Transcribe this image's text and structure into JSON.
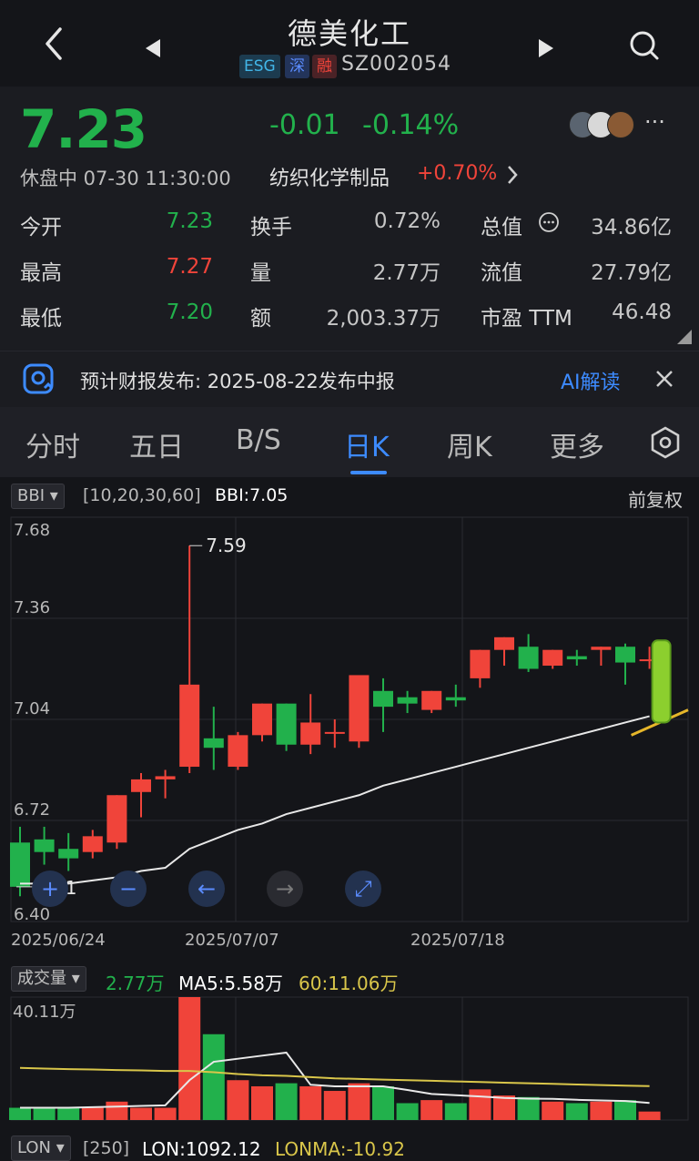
{
  "header": {
    "back_icon": "chevron-left-icon",
    "prev_icon": "triangle-left-icon",
    "next_icon": "triangle-right-icon",
    "search_icon": "search-icon",
    "title": "德美化工",
    "badges": [
      "ESG",
      "深",
      "融"
    ],
    "code": "SZ002054"
  },
  "quote": {
    "price": "7.23",
    "change": "-0.01",
    "change_pct": "-0.14%",
    "status": "休盘中 07-30 11:30:00",
    "sector": "纺织化学制品",
    "sector_change": "+0.70%",
    "more_icon": "more-icon",
    "rows": [
      {
        "l1": "今开",
        "v1": "7.23",
        "l2": "换手",
        "v2": "0.72%",
        "l3": "总值",
        "v3": "34.86亿"
      },
      {
        "l1": "最高",
        "v1": "7.27",
        "l2": "量",
        "v2": "2.77万",
        "l3": "流值",
        "v3": "27.79亿"
      },
      {
        "l1": "最低",
        "v1": "7.20",
        "l2": "额",
        "v2": "2,003.37万",
        "l3": "市盈 TTM",
        "v3": "46.48"
      }
    ]
  },
  "notice": {
    "text": "预计财报发布: 2025-08-22发布中报",
    "ai_label": "AI解读",
    "close_icon": "close-icon"
  },
  "tabs": [
    "分时",
    "五日",
    "B/S",
    "日K",
    "周K",
    "更多"
  ],
  "active_tab": "日K",
  "kline": {
    "indicator": "BBI",
    "params": "[10,20,30,60]",
    "bbi_value": "BBI:7.05",
    "adjust": "前复权",
    "y_ticks": [
      "7.68",
      "7.36",
      "7.04",
      "6.72",
      "6.40"
    ],
    "x_ticks": [
      "2025/06/24",
      "2025/07/07",
      "2025/07/18"
    ],
    "high_label": "7.59",
    "low_label": "6.51",
    "controls": [
      "zoom-in-icon",
      "zoom-out-icon",
      "pan-left-icon",
      "pan-right-icon",
      "reset-icon"
    ]
  },
  "volume": {
    "indicator": "成交量",
    "vol": "2.77万",
    "ma5": "MA5:5.58万",
    "ma60": "60:11.06万",
    "max_label": "40.11万"
  },
  "lon": {
    "indicator": "LON",
    "params": "[250]",
    "lon": "LON:1092.12",
    "lonma": "LONMA:-10.92"
  },
  "colors": {
    "up": "#f0443a",
    "down": "#22b14c",
    "accent": "#3d8bff",
    "bbi": "#e8e8e8",
    "ma60": "#d9c64a"
  },
  "chart_data": {
    "type": "candlestick",
    "ylim": [
      6.4,
      7.68
    ],
    "candles": [
      {
        "o": 6.65,
        "c": 6.51,
        "h": 6.7,
        "l": 6.48
      },
      {
        "o": 6.66,
        "c": 6.62,
        "h": 6.7,
        "l": 6.58
      },
      {
        "o": 6.63,
        "c": 6.6,
        "h": 6.68,
        "l": 6.56
      },
      {
        "o": 6.62,
        "c": 6.67,
        "h": 6.69,
        "l": 6.6
      },
      {
        "o": 6.65,
        "c": 6.8,
        "h": 6.8,
        "l": 6.63
      },
      {
        "o": 6.81,
        "c": 6.85,
        "h": 6.87,
        "l": 6.73
      },
      {
        "o": 6.85,
        "c": 6.86,
        "h": 6.88,
        "l": 6.79
      },
      {
        "o": 6.89,
        "c": 7.15,
        "h": 7.59,
        "l": 6.87
      },
      {
        "o": 6.98,
        "c": 6.95,
        "h": 7.08,
        "l": 6.88
      },
      {
        "o": 6.89,
        "c": 6.99,
        "h": 7.0,
        "l": 6.88
      },
      {
        "o": 6.99,
        "c": 7.09,
        "h": 7.09,
        "l": 6.97
      },
      {
        "o": 7.09,
        "c": 6.96,
        "h": 7.09,
        "l": 6.94
      },
      {
        "o": 6.96,
        "c": 7.03,
        "h": 7.12,
        "l": 6.93
      },
      {
        "o": 7.0,
        "c": 7.0,
        "h": 7.04,
        "l": 6.95
      },
      {
        "o": 6.97,
        "c": 7.18,
        "h": 7.18,
        "l": 6.95
      },
      {
        "o": 7.13,
        "c": 7.08,
        "h": 7.17,
        "l": 7.0
      },
      {
        "o": 7.11,
        "c": 7.09,
        "h": 7.13,
        "l": 7.06
      },
      {
        "o": 7.07,
        "c": 7.13,
        "h": 7.13,
        "l": 7.06
      },
      {
        "o": 7.11,
        "c": 7.1,
        "h": 7.15,
        "l": 7.08
      },
      {
        "o": 7.17,
        "c": 7.26,
        "h": 7.26,
        "l": 7.14
      },
      {
        "o": 7.26,
        "c": 7.3,
        "h": 7.3,
        "l": 7.21
      },
      {
        "o": 7.27,
        "c": 7.2,
        "h": 7.31,
        "l": 7.19
      },
      {
        "o": 7.21,
        "c": 7.26,
        "h": 7.26,
        "l": 7.2
      },
      {
        "o": 7.24,
        "c": 7.23,
        "h": 7.26,
        "l": 7.21
      },
      {
        "o": 7.26,
        "c": 7.27,
        "h": 7.27,
        "l": 7.21
      },
      {
        "o": 7.27,
        "c": 7.22,
        "h": 7.28,
        "l": 7.15
      },
      {
        "o": 7.23,
        "c": 7.23,
        "h": 7.27,
        "l": 7.2
      }
    ],
    "bbi": [
      6.52,
      6.52,
      6.52,
      6.53,
      6.54,
      6.56,
      6.57,
      6.63,
      6.66,
      6.69,
      6.71,
      6.74,
      6.76,
      6.78,
      6.8,
      6.83,
      6.85,
      6.87,
      6.89,
      6.91,
      6.93,
      6.95,
      6.97,
      6.99,
      7.01,
      7.03,
      7.05
    ],
    "volume": [
      4.0,
      4.0,
      4.0,
      4.0,
      6.0,
      4.0,
      4.0,
      40.11,
      28.0,
      13.0,
      11.0,
      12.0,
      11.0,
      9.5,
      12.0,
      11.0,
      5.5,
      6.5,
      5.5,
      10.0,
      8.0,
      7.5,
      6.0,
      5.5,
      6.0,
      6.5,
      2.77
    ],
    "vol_ma5": [
      4.0,
      4.0,
      4.0,
      4.2,
      4.4,
      4.6,
      4.8,
      13.0,
      19.0,
      20.0,
      21.0,
      22.0,
      11.5,
      11.0,
      11.0,
      11.0,
      9.8,
      8.5,
      8.1,
      7.7,
      7.2,
      7.0,
      6.9,
      6.6,
      6.4,
      6.2,
      5.58
    ],
    "vol_ma60": [
      17.0,
      16.8,
      16.6,
      16.5,
      16.3,
      16.2,
      16.0,
      16.0,
      15.6,
      15.0,
      14.6,
      14.4,
      14.0,
      13.6,
      13.4,
      13.2,
      13.0,
      12.8,
      12.6,
      12.4,
      12.2,
      12.0,
      11.8,
      11.6,
      11.4,
      11.2,
      11.06
    ]
  }
}
